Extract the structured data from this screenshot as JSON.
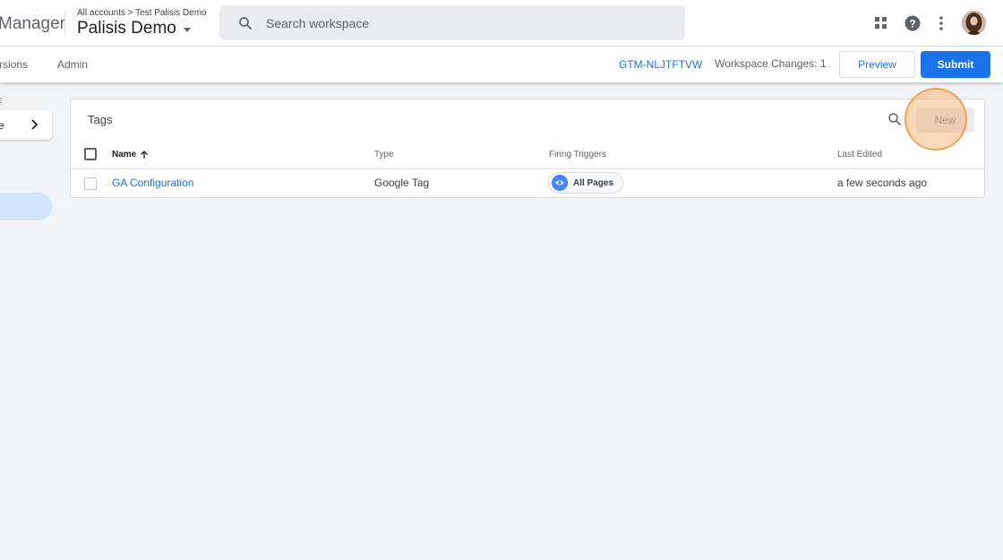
{
  "header": {
    "product_name": "Manager",
    "breadcrumb": "All accounts > Test Palisis Demo",
    "container_name": "Palisis Demo",
    "search_placeholder": "Search workspace",
    "icons": [
      "apps-icon",
      "help-icon",
      "more-vert-icon",
      "avatar"
    ]
  },
  "subnav": {
    "tabs": [
      {
        "label": "rsions"
      },
      {
        "label": "Admin"
      }
    ],
    "container_id": "GTM-NLJTFTVW",
    "workspace_changes": "Workspace Changes: 1",
    "preview_label": "Preview",
    "submit_label": "Submit"
  },
  "sidebar": {
    "section_label": "E",
    "workspace_label": "e"
  },
  "tags_card": {
    "title": "Tags",
    "new_label": "New",
    "columns": {
      "name": "Name",
      "type": "Type",
      "triggers": "Firing Triggers",
      "last_edited": "Last Edited"
    },
    "rows": [
      {
        "name": "GA Configuration",
        "type": "Google Tag",
        "trigger": "All Pages",
        "last_edited": "a few seconds ago"
      }
    ]
  },
  "colors": {
    "accent": "#1a73e8",
    "chip_icon": "#4285f4",
    "click_highlight": "#f2994a",
    "active_nav": "#d2e3fc",
    "background": "#f1f3f4"
  }
}
